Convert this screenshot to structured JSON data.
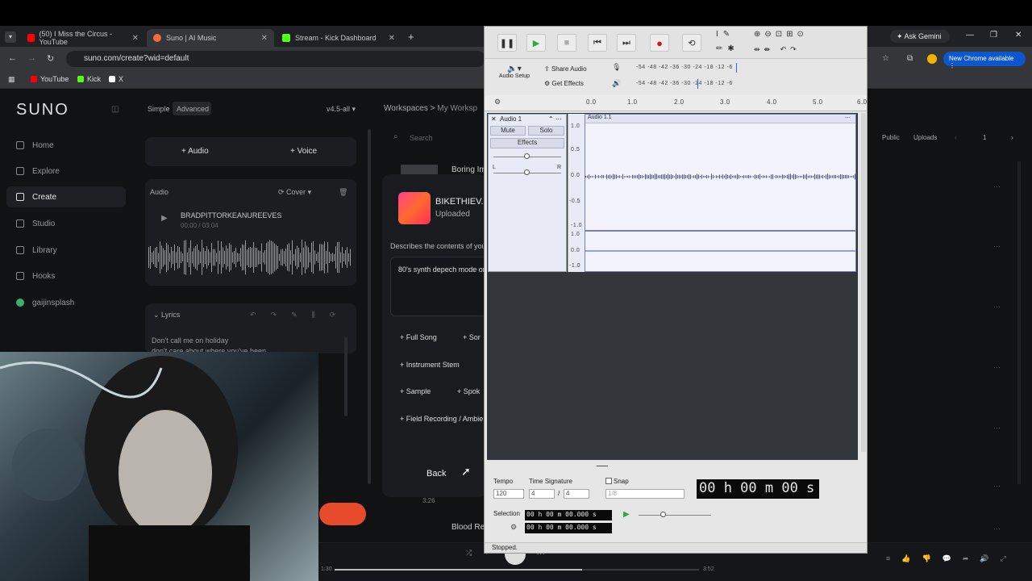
{
  "browser": {
    "tabs": [
      {
        "label": "(50) I Miss the Circus - YouTube",
        "color": "#ff0000"
      },
      {
        "label": "Suno | AI Music",
        "color": "#f26b3a"
      },
      {
        "label": "Stream - Kick Dashboard",
        "color": "#53fc18"
      }
    ],
    "url": "suno.com/create?wid=default",
    "bookmarks": [
      "YouTube",
      "Kick",
      "X"
    ],
    "ask_gemini": "Ask Gemini",
    "new_chrome": "New Chrome available"
  },
  "suno": {
    "logo": "SUNO",
    "mode_simple": "Simple",
    "mode_advanced": "Advanced",
    "model": "v4.5-all",
    "nav": [
      "Home",
      "Explore",
      "Create",
      "Studio",
      "Library",
      "Hooks",
      "gaijinsplash"
    ],
    "add_audio": "+  Audio",
    "add_voice": "+  Voice",
    "audio_label": "Audio",
    "cover_label": "Cover",
    "track_title": "BRADPITTORKEANUREEVES",
    "track_time": "00:00 / 03:04",
    "lyrics_label": "Lyrics",
    "lyrics_line1": "Don't call me on holiday",
    "lyrics_line2": "don't care about where you've been",
    "breadcrumb_workspaces": "Workspaces",
    "breadcrumb_sep": ">",
    "breadcrumb_current": "My Worksp",
    "search_placeholder": "Search",
    "public": "Public",
    "uploads": "Uploads",
    "page_num": "1",
    "upload_title": "BIKETHIEV...",
    "upload_status": "Uploaded",
    "describes": "Describes the contents of you",
    "prompt_text": "80's synth depech mode or",
    "options": [
      "+ Full Song",
      "+ Sor",
      "+ Instrument Stem",
      "+ Sample",
      "+ Spok",
      "+ Field Recording / Ambie"
    ],
    "back": "Back",
    "list_song1": "Boring Im",
    "list_song2": "Blood Re",
    "list_duration": "3:26",
    "player_time_left": "1:30",
    "player_time_right": "3:52"
  },
  "audacity": {
    "share_audio": "Share Audio",
    "get_effects": "Get Effects",
    "audio_setup": "Audio Setup",
    "meter_scale": "-54 -48 -42 -36 -30 -24 -18 -12  -6",
    "ruler": [
      "0.0",
      "1.0",
      "2.0",
      "3.0",
      "4.0",
      "5.0",
      "6.0"
    ],
    "track_name": "Audio 1",
    "clip_name": "Audio 1.1",
    "mute": "Mute",
    "solo": "Solo",
    "effects": "Effects",
    "pan_l": "L",
    "pan_r": "R",
    "scale_top": [
      "1.0",
      "0.5",
      "0.0",
      "-0.5",
      "-1.0"
    ],
    "scale_bottom": [
      "1.0",
      "0.0",
      "-1.0"
    ],
    "tempo_label": "Tempo",
    "tempo": "120",
    "timesig_label": "Time Signature",
    "timesig_num": "4",
    "timesig_slash": "/",
    "timesig_den": "4",
    "snap_label": "Snap",
    "snap_value": "1/8",
    "big_time": "00 h 00 m 00 s",
    "selection_label": "Selection",
    "sel_start": "00 h 00 m 00.000 s",
    "sel_end": "00 h 00 m 00.000 s",
    "status": "Stopped."
  },
  "colors": {
    "waveform": "#3b47c8",
    "record": "#d11b1b",
    "play": "#2eaa3c",
    "suno_accent": "#e84a2c"
  }
}
